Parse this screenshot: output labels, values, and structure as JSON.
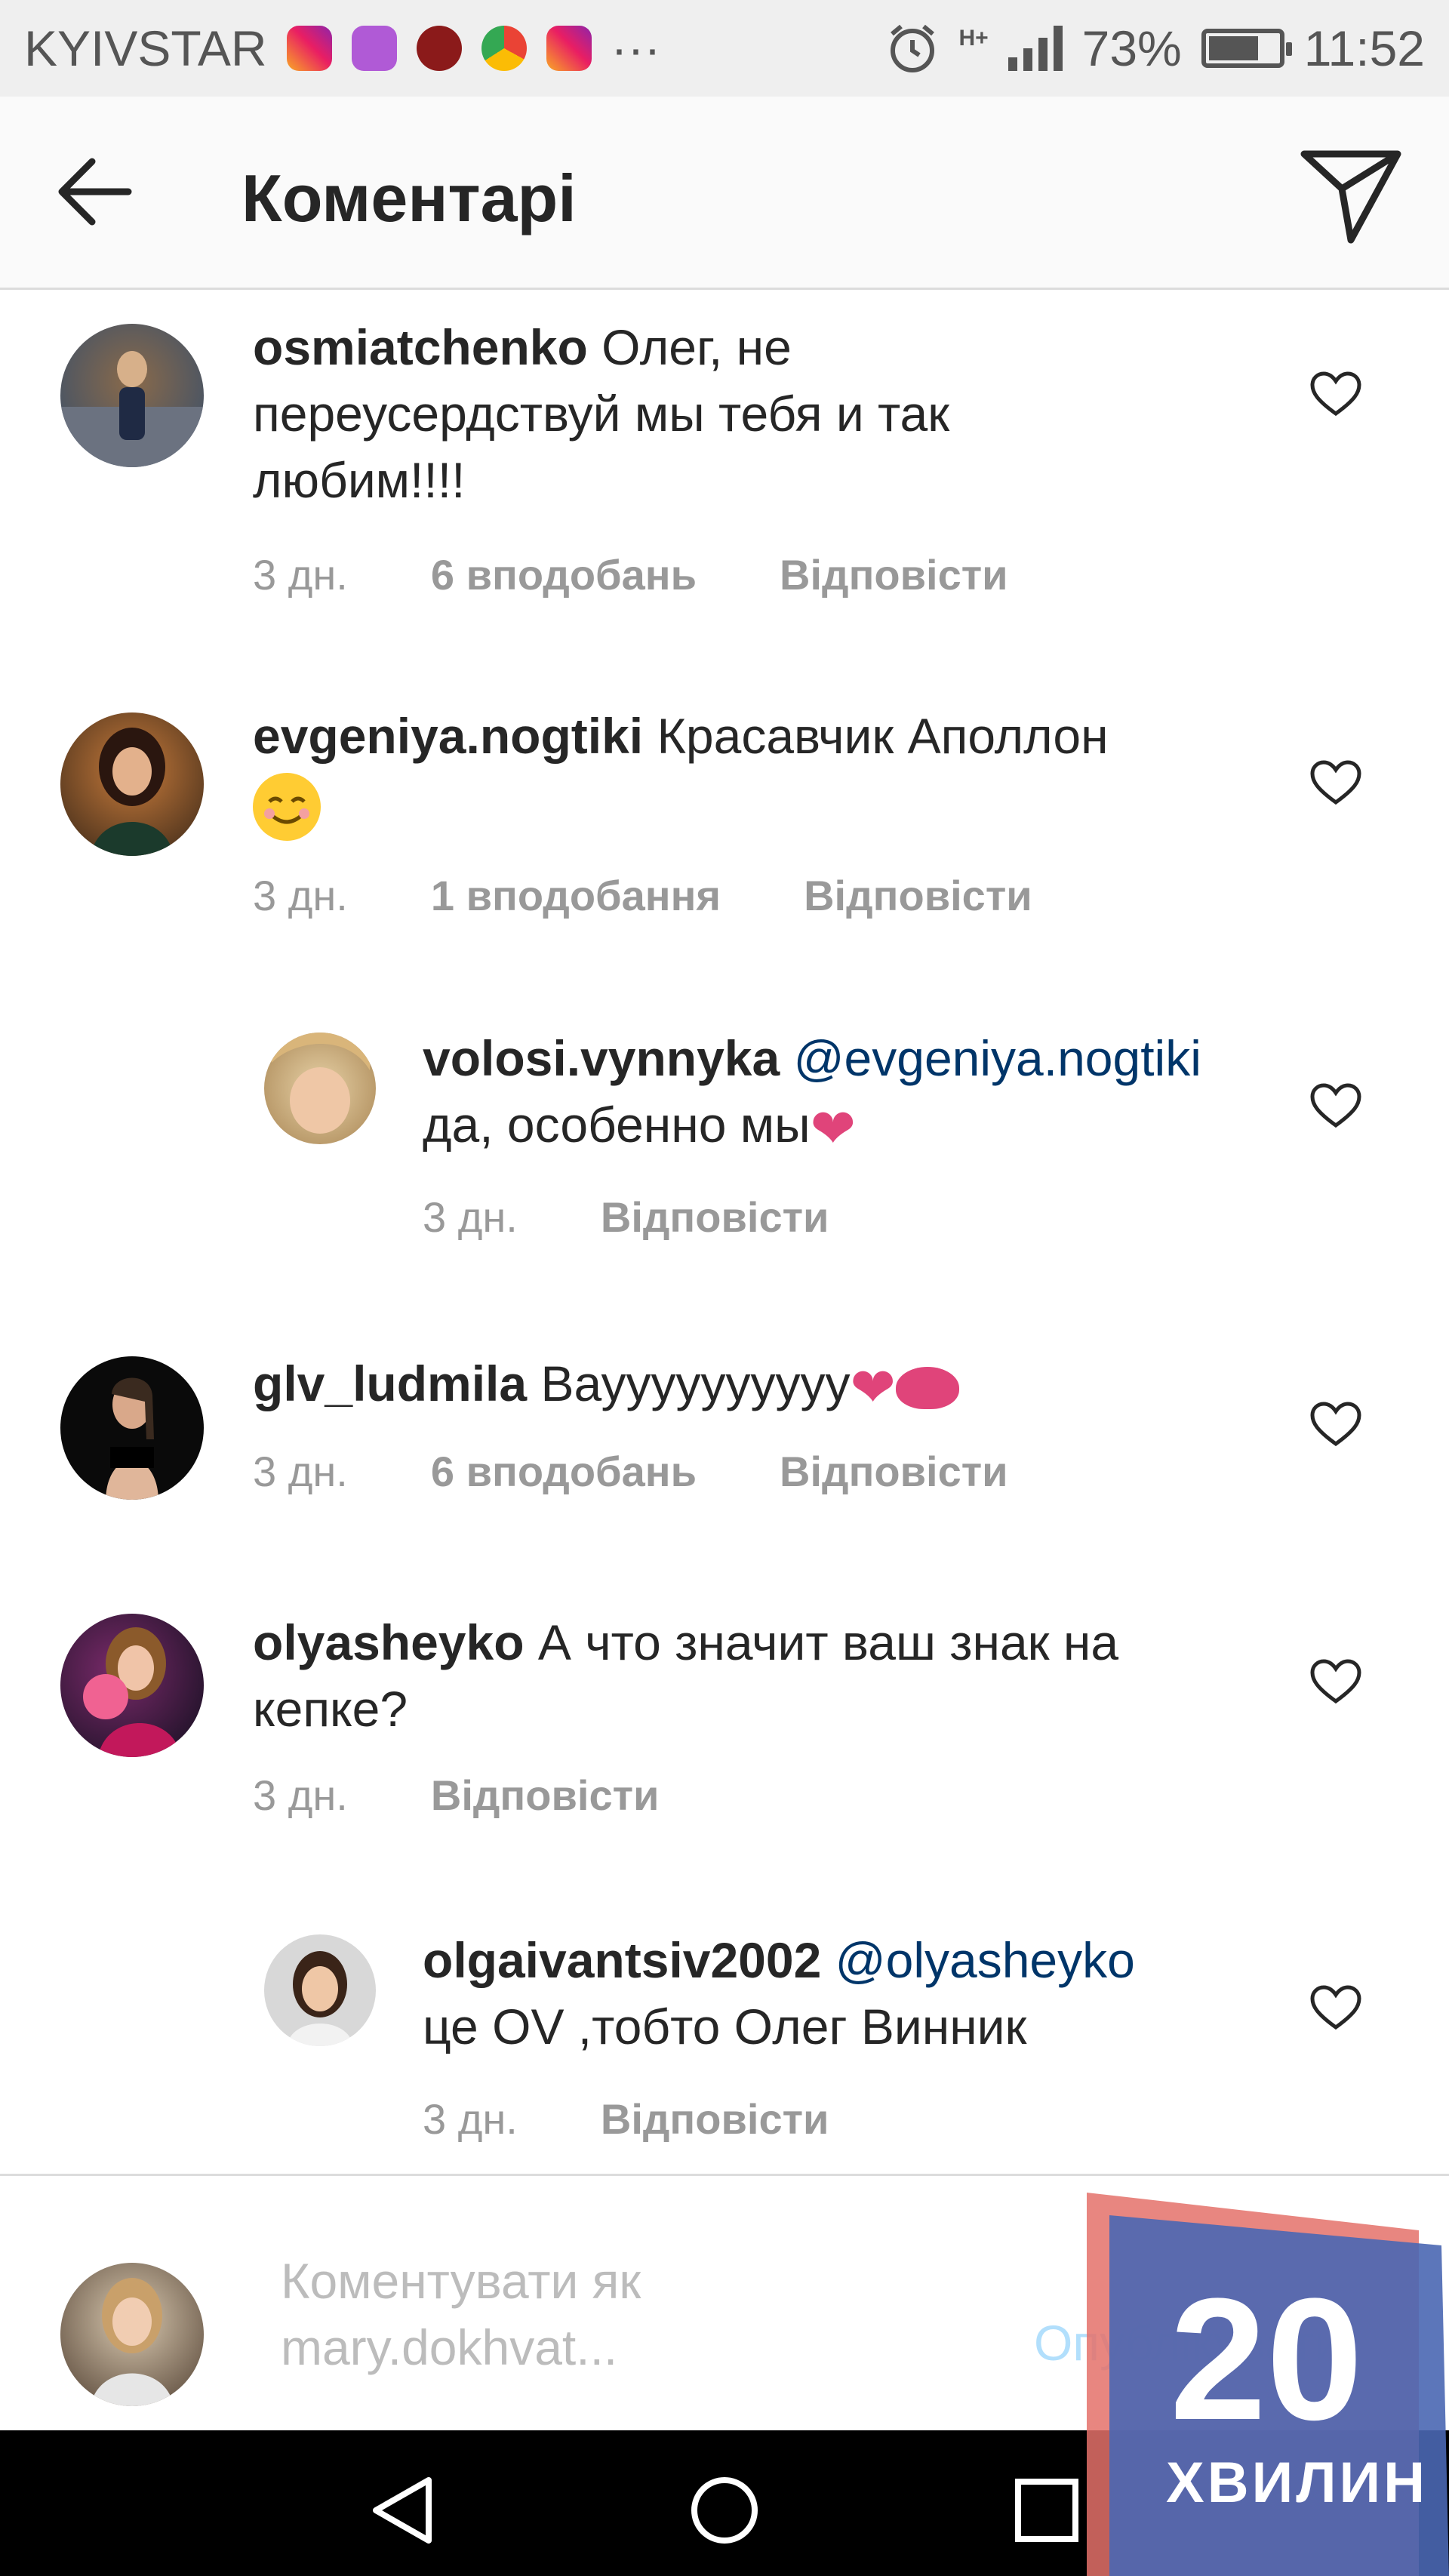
{
  "status_bar": {
    "carrier": "KYIVSTAR",
    "more": "···",
    "network": "H+",
    "battery_percent": "73%",
    "battery_level": 0.73,
    "time": "11:52"
  },
  "header": {
    "title": "Коментарі"
  },
  "comments": [
    {
      "username": "osmiatchenko",
      "line1": "Олег, не",
      "line2": "переусердствуй мы тебя и так",
      "line3": "любим!!!!",
      "time": "3 дн.",
      "likes": "6 вподобань",
      "reply": "Відповісти"
    },
    {
      "username": "evgeniya.nogtiki",
      "line1": "Красавчик Аполлон",
      "time": "3 дн.",
      "likes": "1 вподобання",
      "reply": "Відповісти"
    },
    {
      "username": "volosi.vynnyka",
      "mention": "@evgeniya.nogtiki",
      "line2": "да, особенно мы",
      "time": "3 дн.",
      "reply": "Відповісти"
    },
    {
      "username": "glv_ludmila",
      "line1": "Вауууууууууу",
      "time": "3 дн.",
      "likes": "6 вподобань",
      "reply": "Відповісти"
    },
    {
      "username": "olyasheyko",
      "line1": "А что значит ваш знак на",
      "line2": "кепке?",
      "time": "3 дн.",
      "reply": "Відповісти"
    },
    {
      "username": "olgaivantsiv2002",
      "mention": "@olyasheyko",
      "line2": "це OV ,тобто Олег Винник",
      "time": "3 дн.",
      "reply": "Відповісти"
    }
  ],
  "comment_input": {
    "placeholder_line1": "Коментувати як",
    "placeholder_line2": "mary.dokhvat...",
    "publish": "Опублікувати"
  },
  "watermark": {
    "number": "20",
    "word": "ХВИЛИН"
  },
  "icons": [
    "back-arrow-icon",
    "send-icon",
    "heart-icon",
    "nav-back-icon",
    "nav-home-icon",
    "nav-recents-icon"
  ]
}
